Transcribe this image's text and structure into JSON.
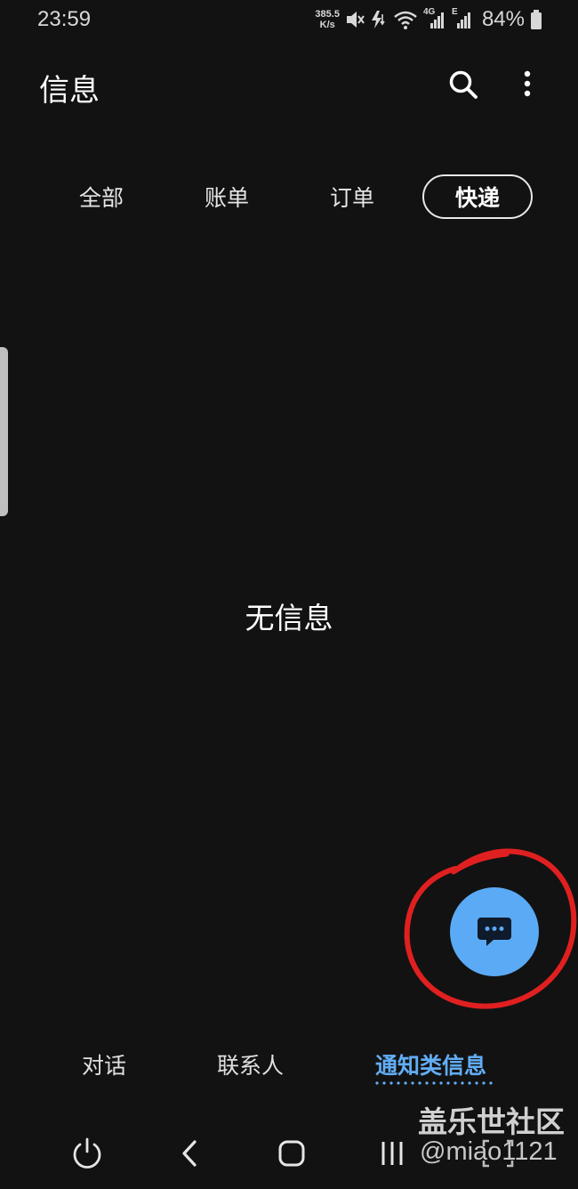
{
  "status_bar": {
    "time": "23:59",
    "net_speed_value": "385.5",
    "net_speed_unit": "K/s",
    "network_4g": "4G",
    "network_e": "E",
    "battery_percent": "84%",
    "icons": [
      "mute-icon",
      "data-transfer-icon",
      "wifi-icon",
      "signal-4g-icon",
      "signal-e-icon",
      "battery-icon"
    ]
  },
  "header": {
    "title": "信息",
    "search_icon": "search-icon",
    "more_icon": "more-vertical-icon"
  },
  "tabs": [
    {
      "label": "全部",
      "active": false
    },
    {
      "label": "账单",
      "active": false
    },
    {
      "label": "订单",
      "active": false
    },
    {
      "label": "快递",
      "active": true
    }
  ],
  "main": {
    "empty_message": "无信息"
  },
  "fab": {
    "icon": "chat-bubble-icon",
    "accent_color": "#5aaaf5",
    "highlight_ring_color": "#e02020"
  },
  "bottom_nav": {
    "items": [
      {
        "label": "对话",
        "active": false
      },
      {
        "label": "联系人",
        "active": false
      },
      {
        "label": "通知类信息",
        "active": true
      }
    ],
    "active_color": "#62adf5"
  },
  "system_nav": {
    "icons": [
      "power-icon",
      "back-icon",
      "home-icon",
      "recents-icon",
      "screenshot-icon"
    ]
  },
  "watermark": {
    "line1": "盖乐世社区",
    "line2": "@miao1121"
  }
}
